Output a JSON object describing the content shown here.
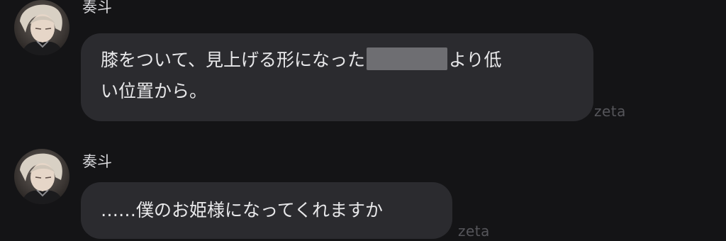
{
  "messages": [
    {
      "sender": "奏斗",
      "avatar_icon": "character-avatar",
      "text_line1_before": "膝をついて、見上げる形になった",
      "text_line1_after": "より低",
      "text_line2": "い位置から。",
      "redacted": true,
      "brand": "zeta"
    },
    {
      "sender": "奏斗",
      "avatar_icon": "character-avatar",
      "text": "……僕のお姫様になってくれますか",
      "brand": "zeta"
    }
  ],
  "colors": {
    "background": "#141416",
    "bubble": "#2b2b2f",
    "text": "#e8e8ea",
    "brand": "#55555a",
    "redaction": "#6e6e72"
  }
}
